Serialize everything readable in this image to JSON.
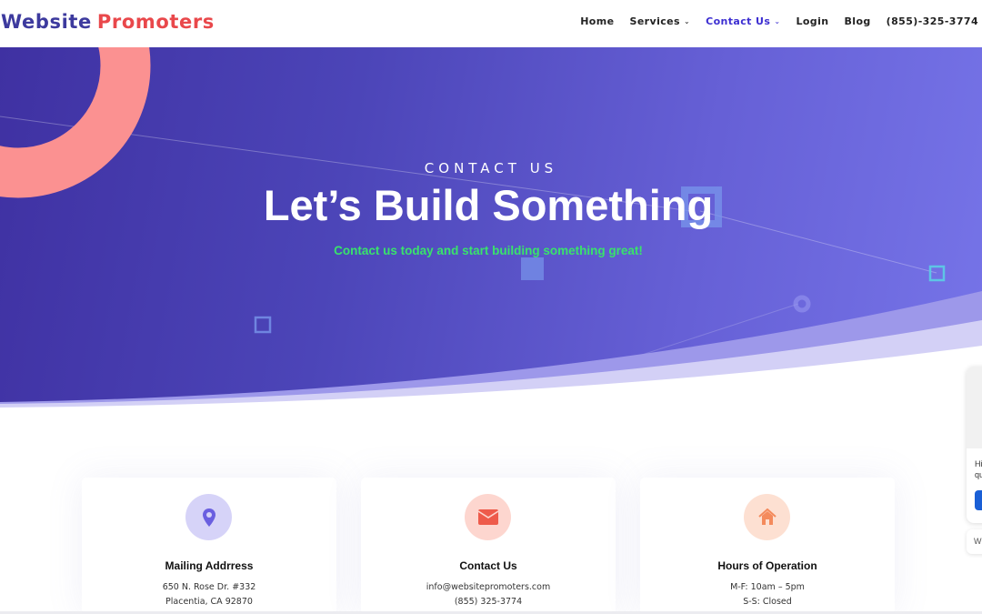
{
  "header": {
    "logo_part1": "Website",
    "logo_part2": "Promoters",
    "nav": [
      {
        "label": "Home",
        "has_dropdown": false,
        "active": false
      },
      {
        "label": "Services",
        "has_dropdown": true,
        "active": false
      },
      {
        "label": "Contact Us",
        "has_dropdown": true,
        "active": true
      },
      {
        "label": "Login",
        "has_dropdown": false,
        "active": false
      },
      {
        "label": "Blog",
        "has_dropdown": false,
        "active": false
      },
      {
        "label": "(855)-325-3774",
        "has_dropdown": false,
        "active": false
      }
    ],
    "dropdown_icon": "chevron-down-icon"
  },
  "hero": {
    "eyebrow": "CONTACT US",
    "title": "Let’s Build Something",
    "subtitle": "Contact us today and start building something great!"
  },
  "cards": [
    {
      "icon": "map-pin-icon",
      "title": "Mailing Addrress",
      "line1": "650 N. Rose Dr. #332",
      "line2": "Placentia, CA 92870"
    },
    {
      "icon": "envelope-icon",
      "title": "Contact Us",
      "line1": "info@websitepromoters.com",
      "line2": "(855) 325-3774"
    },
    {
      "icon": "home-icon",
      "title": "Hours of Operation",
      "line1": "M-F: 10am – 5pm",
      "line2": "S-S: Closed"
    }
  ],
  "chat_widget": {
    "text_line1": "Hi",
    "text_line2": "qu",
    "secondary_text": "W"
  },
  "colors": {
    "brand_blue": "#3d3a9e",
    "brand_red": "#e9484b",
    "nav_active": "#3c2ed1",
    "hero_subtitle": "#39e36b",
    "ring_coral": "#fb9191",
    "card1_icon_bg": "#d6d3f8",
    "card1_icon": "#6a5fe0",
    "card2_icon_bg": "#fdd6cf",
    "card2_icon": "#ee5b4b",
    "card3_icon_bg": "#fde0d2",
    "card3_icon": "#f48a5c"
  }
}
